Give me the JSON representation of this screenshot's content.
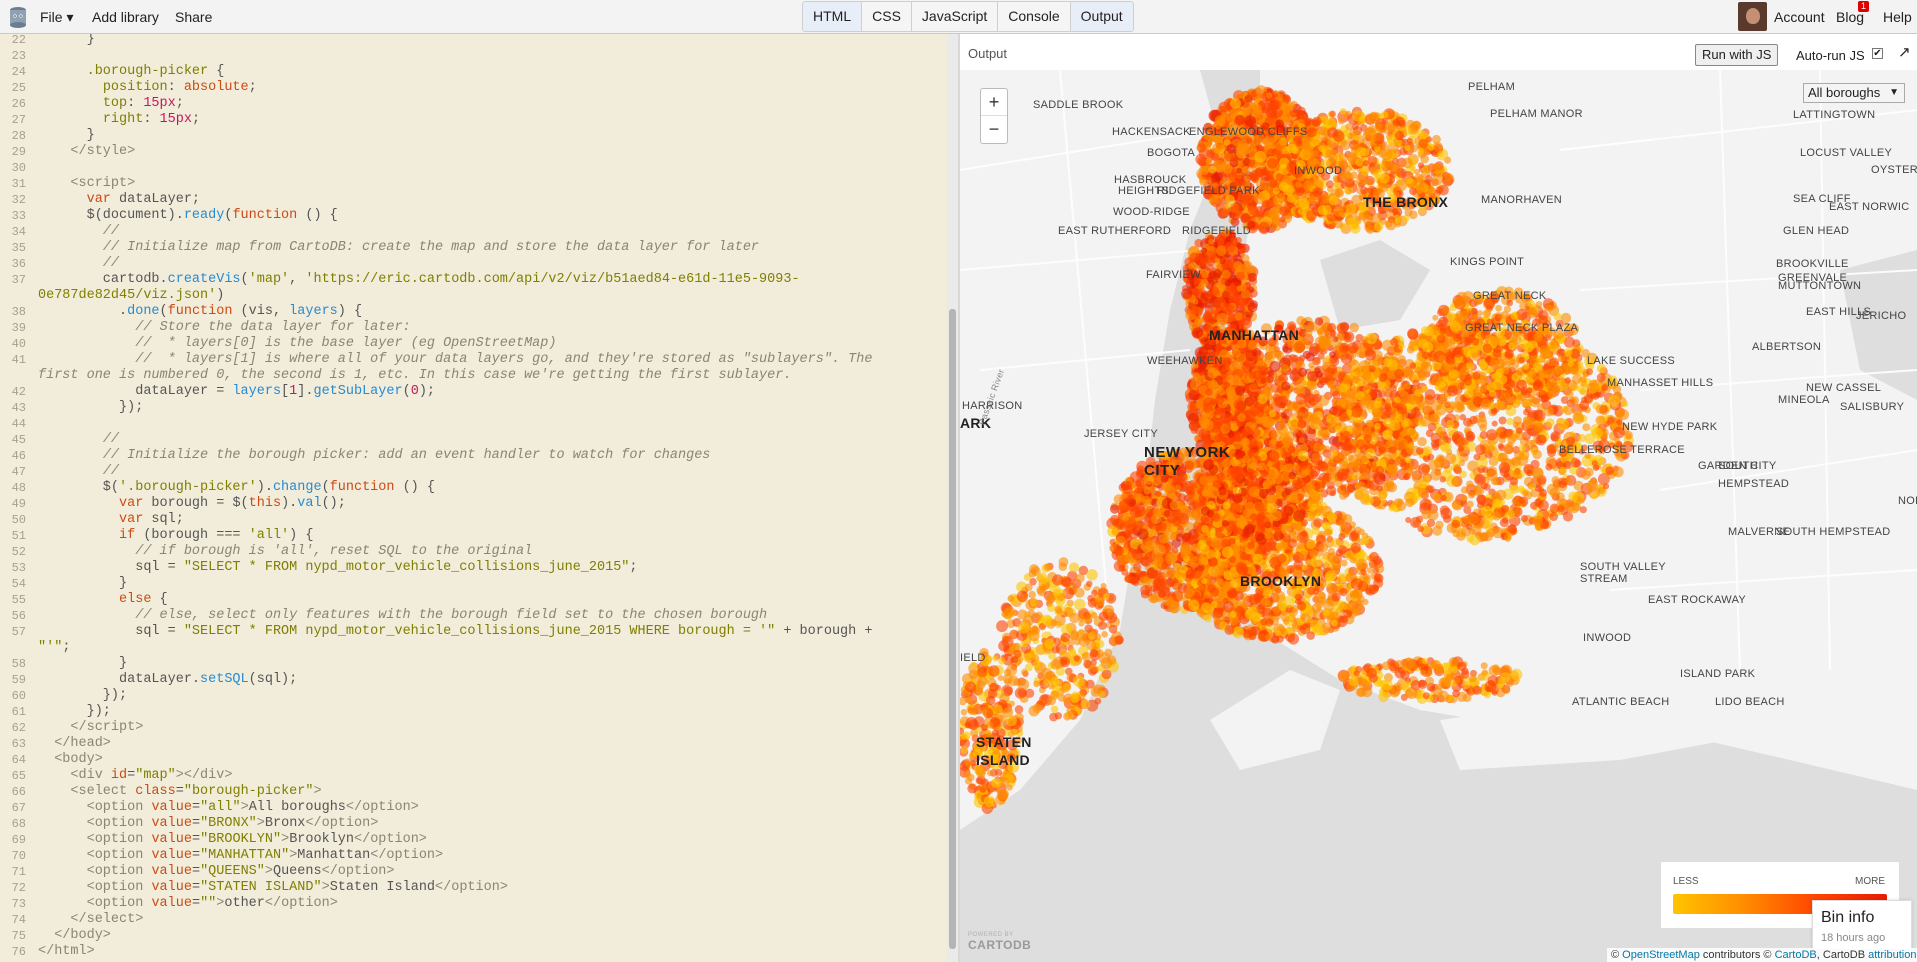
{
  "app": {
    "menu": [
      {
        "id": "file",
        "label": "File ▾"
      },
      {
        "id": "add-library",
        "label": "Add library"
      },
      {
        "id": "share",
        "label": "Share"
      }
    ],
    "tabs": [
      "HTML",
      "CSS",
      "JavaScript",
      "Console",
      "Output"
    ],
    "active_tabs": [
      "HTML",
      "Output"
    ],
    "right_menu": {
      "account": "Account",
      "blog": "Blog",
      "blog_badge": "1",
      "help": "Help"
    }
  },
  "editor": {
    "lines": [
      {
        "n": "22",
        "html": "      }"
      },
      {
        "n": "23",
        "html": ""
      },
      {
        "n": "24",
        "html": "      <span class=\"str\">.borough-picker</span> {"
      },
      {
        "n": "25",
        "html": "        <span class=\"str\">position</span>: <span class=\"kw\">absolute</span>;"
      },
      {
        "n": "26",
        "html": "        <span class=\"str\">top</span>: <span class=\"num\">15px</span>;"
      },
      {
        "n": "27",
        "html": "        <span class=\"str\">right</span>: <span class=\"num\">15px</span>;"
      },
      {
        "n": "28",
        "html": "      }"
      },
      {
        "n": "29",
        "html": "    <span class=\"tag\">&lt;/style&gt;</span>"
      },
      {
        "n": "30",
        "html": ""
      },
      {
        "n": "31",
        "html": "    <span class=\"tag\">&lt;script&gt;</span>"
      },
      {
        "n": "32",
        "html": "      <span class=\"kw\">var</span> dataLayer;"
      },
      {
        "n": "33",
        "html": "      $(document).<span class=\"fn\">ready</span>(<span class=\"kw\">function</span> () {"
      },
      {
        "n": "34",
        "html": "        <span class=\"cm\">//</span>"
      },
      {
        "n": "35",
        "html": "        <span class=\"cm\">// Initialize map from CartoDB: create the map and store the data layer for later</span>"
      },
      {
        "n": "36",
        "html": "        <span class=\"cm\">//</span>"
      },
      {
        "n": "37",
        "html": "        cartodb.<span class=\"fn\">createVis</span>(<span class=\"str\">'map'</span>, <span class=\"str\">'https://eric.cartodb.com/api/v2/viz/b51aed84-e61d-11e5-9093-</span>",
        "cont": "<span class=\"str\">0e787de82d45/viz.json'</span>)"
      },
      {
        "n": "38",
        "html": "          .<span class=\"fn\">done</span>(<span class=\"kw\">function</span> (vis, <span class=\"fn\">layers</span>) {"
      },
      {
        "n": "39",
        "html": "            <span class=\"cm\">// Store the data layer for later:</span>"
      },
      {
        "n": "40",
        "html": "            <span class=\"cm\">//  * layers[0] is the base layer (eg OpenStreetMap)</span>"
      },
      {
        "n": "41",
        "html": "            <span class=\"cm\">//  * layers[1] is where all of your data layers go, and they're stored as \"sublayers\". The</span>",
        "cont": "<span class=\"cm\">first one is numbered 0, the second is 1, etc. In this case we're getting the first sublayer.</span>"
      },
      {
        "n": "42",
        "html": "            dataLayer = <span class=\"fn\">layers</span>[<span class=\"num\">1</span>].<span class=\"fn\">getSubLayer</span>(<span class=\"num\">0</span>);"
      },
      {
        "n": "43",
        "html": "          });"
      },
      {
        "n": "44",
        "html": ""
      },
      {
        "n": "45",
        "html": "        <span class=\"cm\">//</span>"
      },
      {
        "n": "46",
        "html": "        <span class=\"cm\">// Initialize the borough picker: add an event handler to watch for changes</span>"
      },
      {
        "n": "47",
        "html": "        <span class=\"cm\">//</span>"
      },
      {
        "n": "48",
        "html": "        $(<span class=\"str\">'.borough-picker'</span>).<span class=\"fn\">change</span>(<span class=\"kw\">function</span> () {"
      },
      {
        "n": "49",
        "html": "          <span class=\"kw\">var</span> borough = $(<span class=\"kw\">this</span>).<span class=\"fn\">val</span>();"
      },
      {
        "n": "50",
        "html": "          <span class=\"kw\">var</span> sql;"
      },
      {
        "n": "51",
        "html": "          <span class=\"kw\">if</span> (borough === <span class=\"str\">'all'</span>) {"
      },
      {
        "n": "52",
        "html": "            <span class=\"cm\">// if borough is 'all', reset SQL to the original</span>"
      },
      {
        "n": "53",
        "html": "            sql = <span class=\"str\">\"SELECT * FROM nypd_motor_vehicle_collisions_june_2015\"</span>;"
      },
      {
        "n": "54",
        "html": "          }"
      },
      {
        "n": "55",
        "html": "          <span class=\"kw\">else</span> {"
      },
      {
        "n": "56",
        "html": "            <span class=\"cm\">// else, select only features with the borough field set to the chosen borough</span>"
      },
      {
        "n": "57",
        "html": "            sql = <span class=\"str\">\"SELECT * FROM nypd_motor_vehicle_collisions_june_2015 WHERE borough = '\"</span> + borough +",
        "cont": "<span class=\"str\">\"'\"</span>;"
      },
      {
        "n": "58",
        "html": "          }"
      },
      {
        "n": "59",
        "html": "          dataLayer.<span class=\"fn\">setSQL</span>(sql);"
      },
      {
        "n": "60",
        "html": "        });"
      },
      {
        "n": "61",
        "html": "      });"
      },
      {
        "n": "62",
        "html": "    <span class=\"tag\">&lt;/script&gt;</span>"
      },
      {
        "n": "63",
        "html": "  <span class=\"tag\">&lt;/head&gt;</span>"
      },
      {
        "n": "64",
        "html": "  <span class=\"tag\">&lt;body&gt;</span>"
      },
      {
        "n": "65",
        "html": "    <span class=\"tag\">&lt;div</span> <span class=\"kw\">id</span>=<span class=\"str\">\"map\"</span><span class=\"tag\">&gt;&lt;/div&gt;</span>"
      },
      {
        "n": "66",
        "html": "    <span class=\"tag\">&lt;select</span> <span class=\"kw\">class</span>=<span class=\"str\">\"borough-picker\"</span><span class=\"tag\">&gt;</span>"
      },
      {
        "n": "67",
        "html": "      <span class=\"tag\">&lt;option</span> <span class=\"kw\">value</span>=<span class=\"str\">\"all\"</span><span class=\"tag\">&gt;</span>All boroughs<span class=\"tag\">&lt;/option&gt;</span>"
      },
      {
        "n": "68",
        "html": "      <span class=\"tag\">&lt;option</span> <span class=\"kw\">value</span>=<span class=\"str\">\"BRONX\"</span><span class=\"tag\">&gt;</span>Bronx<span class=\"tag\">&lt;/option&gt;</span>"
      },
      {
        "n": "69",
        "html": "      <span class=\"tag\">&lt;option</span> <span class=\"kw\">value</span>=<span class=\"str\">\"BROOKLYN\"</span><span class=\"tag\">&gt;</span>Brooklyn<span class=\"tag\">&lt;/option&gt;</span>"
      },
      {
        "n": "70",
        "html": "      <span class=\"tag\">&lt;option</span> <span class=\"kw\">value</span>=<span class=\"str\">\"MANHATTAN\"</span><span class=\"tag\">&gt;</span>Manhattan<span class=\"tag\">&lt;/option&gt;</span>"
      },
      {
        "n": "71",
        "html": "      <span class=\"tag\">&lt;option</span> <span class=\"kw\">value</span>=<span class=\"str\">\"QUEENS\"</span><span class=\"tag\">&gt;</span>Queens<span class=\"tag\">&lt;/option&gt;</span>"
      },
      {
        "n": "72",
        "html": "      <span class=\"tag\">&lt;option</span> <span class=\"kw\">value</span>=<span class=\"str\">\"STATEN ISLAND\"</span><span class=\"tag\">&gt;</span>Staten Island<span class=\"tag\">&lt;/option&gt;</span>"
      },
      {
        "n": "73",
        "html": "      <span class=\"tag\">&lt;option</span> <span class=\"kw\">value</span>=<span class=\"str\">\"\"</span><span class=\"tag\">&gt;</span>other<span class=\"tag\">&lt;/option&gt;</span>"
      },
      {
        "n": "74",
        "html": "    <span class=\"tag\">&lt;/select&gt;</span>"
      },
      {
        "n": "75",
        "html": "  <span class=\"tag\">&lt;/body&gt;</span>"
      },
      {
        "n": "76",
        "html": "<span class=\"tag\">&lt;/html&gt;</span>"
      }
    ]
  },
  "output": {
    "label": "Output",
    "run_button": "Run with JS",
    "autorun_label": "Auto-run JS",
    "autorun_checked": "✔",
    "popout_icon": "↗",
    "map": {
      "zoom_in": "+",
      "zoom_out": "−",
      "borough_select": "All boroughs",
      "labels": [
        {
          "t": "SADDLE BROOK",
          "cls": ""
        },
        {
          "t": "HACKENSACK",
          "cls": ""
        },
        {
          "t": "BOGOTA",
          "cls": ""
        },
        {
          "t": "ENGLEWOOD CLIFFS",
          "cls": ""
        },
        {
          "t": "PELHAM",
          "cls": ""
        },
        {
          "t": "PELHAM MANOR",
          "cls": ""
        },
        {
          "t": "LATTINGTOWN",
          "cls": ""
        },
        {
          "t": "LOCUST VALLEY",
          "cls": ""
        },
        {
          "t": "OYSTER BA",
          "cls": ""
        },
        {
          "t": "INWOOD",
          "cls": ""
        },
        {
          "t": "HASBROUCK",
          "cls": ""
        },
        {
          "t": "HEIGHTS",
          "cls": ""
        },
        {
          "t": "RIDGEFIELD PARK",
          "cls": ""
        },
        {
          "t": "THE BRONX",
          "cls": "mid"
        },
        {
          "t": "MANORHAVEN",
          "cls": ""
        },
        {
          "t": "SEA CLIFF",
          "cls": ""
        },
        {
          "t": "EAST NORWIC",
          "cls": ""
        },
        {
          "t": "WOOD-RIDGE",
          "cls": ""
        },
        {
          "t": "EAST RUTHERFORD",
          "cls": ""
        },
        {
          "t": "RIDGEFIELD",
          "cls": ""
        },
        {
          "t": "GLEN HEAD",
          "cls": ""
        },
        {
          "t": "BROOKVILLE",
          "cls": ""
        },
        {
          "t": "KINGS POINT",
          "cls": ""
        },
        {
          "t": "GREENVALE",
          "cls": ""
        },
        {
          "t": "MUTTONTOWN",
          "cls": ""
        },
        {
          "t": "FAIRVIEW",
          "cls": ""
        },
        {
          "t": "GREAT NECK",
          "cls": ""
        },
        {
          "t": "EAST HILLS",
          "cls": ""
        },
        {
          "t": "JERICHO",
          "cls": ""
        },
        {
          "t": "MANHATTAN",
          "cls": "mid"
        },
        {
          "t": "GREAT NECK PLAZA",
          "cls": ""
        },
        {
          "t": "ALBERTSON",
          "cls": ""
        },
        {
          "t": "WEEHAWKEN",
          "cls": ""
        },
        {
          "t": "LAKE SUCCESS",
          "cls": ""
        },
        {
          "t": "MANHASSET HILLS",
          "cls": ""
        },
        {
          "t": "NEW CASSEL",
          "cls": ""
        },
        {
          "t": "HARRISON",
          "cls": ""
        },
        {
          "t": "MINEOLA",
          "cls": ""
        },
        {
          "t": "SALISBURY",
          "cls": ""
        },
        {
          "t": "ARK",
          "cls": "mid"
        },
        {
          "t": "NEW HYDE PARK",
          "cls": ""
        },
        {
          "t": "JERSEY CITY",
          "cls": ""
        },
        {
          "t": "NEW YORK",
          "cls": "big"
        },
        {
          "t": "CITY",
          "cls": "big"
        },
        {
          "t": "BELLEROSE TERRACE",
          "cls": ""
        },
        {
          "t": "GARDEN CITY",
          "cls": ""
        },
        {
          "t": "SOUTH",
          "cls": ""
        },
        {
          "t": "HEMPSTEAD",
          "cls": ""
        },
        {
          "t": "NORTH",
          "cls": ""
        },
        {
          "t": "MALVERNE",
          "cls": ""
        },
        {
          "t": "SOUTH HEMPSTEAD",
          "cls": ""
        },
        {
          "t": "BROOKLYN",
          "cls": "mid"
        },
        {
          "t": "SOUTH VALLEY",
          "cls": ""
        },
        {
          "t": "STREAM",
          "cls": ""
        },
        {
          "t": "EAST ROCKAWAY",
          "cls": ""
        },
        {
          "t": "INWOOD",
          "cls": ""
        },
        {
          "t": "IELD",
          "cls": ""
        },
        {
          "t": "ISLAND PARK",
          "cls": ""
        },
        {
          "t": "ATLANTIC BEACH",
          "cls": ""
        },
        {
          "t": "LIDO BEACH",
          "cls": ""
        },
        {
          "t": "STATEN",
          "cls": "mid"
        },
        {
          "t": "ISLAND",
          "cls": "mid"
        },
        {
          "t": "Passaic River",
          "cls": ""
        }
      ],
      "legend": {
        "less": "LESS",
        "more": "MORE",
        "colors": [
          "#ffc400",
          "#ff8c00",
          "#ff4500",
          "#e81c00"
        ]
      },
      "bininfo": {
        "title": "Bin info",
        "time": "18 hours ago"
      },
      "brand": {
        "powered": "POWERED BY",
        "name": "CARTODB"
      },
      "attribution": {
        "prefix": "© ",
        "osm": "OpenStreetMap",
        "mid": " contributors © ",
        "cartodb": "CartoDB",
        "sep": ", CartoDB ",
        "link": "attribution"
      }
    }
  }
}
